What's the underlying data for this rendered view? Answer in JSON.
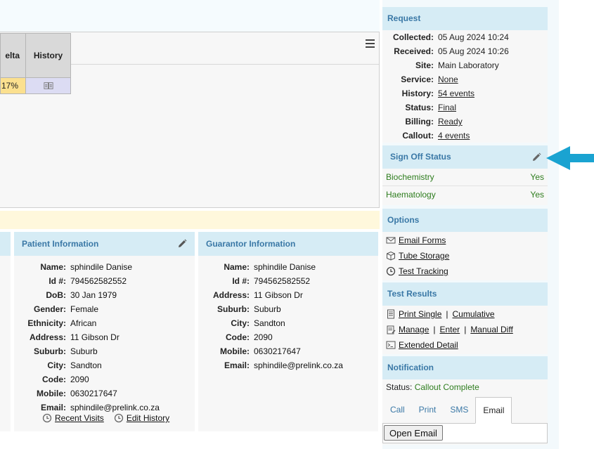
{
  "results": {
    "columns": {
      "delta": "elta",
      "history": "History"
    },
    "row": {
      "delta": "17%"
    }
  },
  "patient": {
    "title": "Patient Information",
    "fields": [
      {
        "label": "Name:",
        "value": "sphindile Danise"
      },
      {
        "label": "Id #:",
        "value": "794562582552"
      },
      {
        "label": "DoB:",
        "value": "30 Jan 1979"
      },
      {
        "label": "Gender:",
        "value": "Female"
      },
      {
        "label": "Ethnicity:",
        "value": "African"
      },
      {
        "label": "Address:",
        "value": "11 Gibson Dr"
      },
      {
        "label": "Suburb:",
        "value": "Suburb"
      },
      {
        "label": "City:",
        "value": "Sandton"
      },
      {
        "label": "Code:",
        "value": "2090"
      },
      {
        "label": "Mobile:",
        "value": "0630217647"
      },
      {
        "label": "Email:",
        "value": "sphindile@prelink.co.za"
      }
    ],
    "links": {
      "recent_visits": "Recent Visits",
      "edit_history": "Edit History"
    }
  },
  "guarantor": {
    "title": "Guarantor Information",
    "fields": [
      {
        "label": "Name:",
        "value": "sphindile Danise"
      },
      {
        "label": "Id #:",
        "value": "794562582552"
      },
      {
        "label": "Address:",
        "value": "11 Gibson Dr"
      },
      {
        "label": "Suburb:",
        "value": "Suburb"
      },
      {
        "label": "City:",
        "value": "Sandton"
      },
      {
        "label": "Code:",
        "value": "2090"
      },
      {
        "label": "Mobile:",
        "value": "0630217647"
      },
      {
        "label": "Email:",
        "value": "sphindile@prelink.co.za"
      }
    ]
  },
  "request": {
    "title": "Request",
    "fields": [
      {
        "label": "Collected:",
        "value": "05 Aug 2024 10:24"
      },
      {
        "label": "Received:",
        "value": "05 Aug 2024 10:26"
      },
      {
        "label": "Site:",
        "value": "Main Laboratory"
      },
      {
        "label": "Service:",
        "value": "None"
      },
      {
        "label": "History:",
        "value": "54 events"
      },
      {
        "label": "Status:",
        "value": "Final"
      },
      {
        "label": "Billing:",
        "value": "Ready"
      },
      {
        "label": "Callout:",
        "value": "4 events"
      }
    ]
  },
  "sign_off": {
    "title": "Sign Off Status",
    "rows": [
      {
        "dept": "Biochemistry",
        "value": "Yes"
      },
      {
        "dept": "Haematology",
        "value": "Yes"
      }
    ]
  },
  "options": {
    "title": "Options",
    "email_forms": "Email Forms",
    "tube_storage": "Tube Storage",
    "test_tracking": "Test Tracking"
  },
  "test_results": {
    "title": "Test Results",
    "print_single": "Print Single",
    "cumulative": "Cumulative",
    "manage": "Manage",
    "enter": "Enter",
    "manual_diff": "Manual Diff",
    "extended_detail": "Extended Detail",
    "sep": "|"
  },
  "notification": {
    "title": "Notification",
    "status_label": "Status:",
    "status_value": "Callout Complete",
    "tabs": [
      "Call",
      "Print",
      "SMS",
      "Email"
    ],
    "active_tab": "Email",
    "open_email": "Open Email"
  },
  "colors": {
    "header_bg": "#d6ecf5",
    "header_text": "#3a78a6",
    "ok_green": "#2e7d1e",
    "delta_yellow": "#fbe08f",
    "history_lavender": "#dcdcf3",
    "arrow": "#1aa3d1"
  }
}
